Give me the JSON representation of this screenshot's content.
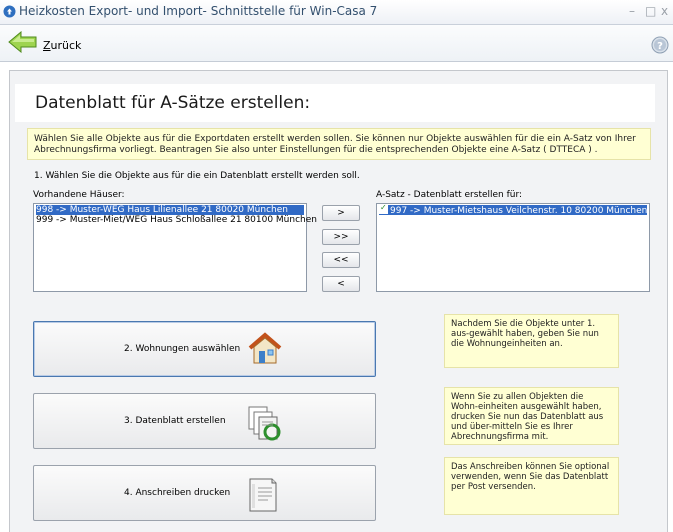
{
  "window": {
    "title": "Heizkosten Export- und Import- Schnittstelle für Win-Casa 7",
    "minimize": "–",
    "maximize": "□",
    "close": "x"
  },
  "toolbar": {
    "back_label_first": "Z",
    "back_label_rest": "urück"
  },
  "page": {
    "title": "Datenblatt für A-Sätze erstellen:",
    "info": "Wählen Sie alle Objekte aus für die Exportdaten erstellt werden sollen. Sie können nur Objekte auswählen für die ein A-Satz von Ihrer Abrechnungsfirma vorliegt. Beantragen Sie also unter Einstellungen für die entsprechenden Objekte eine A-Satz ( DTTECA ) .",
    "step1": "1. Wählen Sie die Objekte aus für die ein Datenblatt erstellt werden soll."
  },
  "available": {
    "label": "Vorhandene Häuser:",
    "items": [
      "998 -> Muster-WEG Haus  Lilienallee 21   80020 München",
      "999 -> Muster-Miet/WEG Haus  Schloßallee 21   80100 München"
    ]
  },
  "selected": {
    "label": "A-Satz - Datenblatt erstellen für:",
    "items": [
      "997 -> Muster-Mietshaus  Veilchenstr. 10   80200 München"
    ]
  },
  "move_buttons": [
    ">",
    ">>",
    "<<",
    "<"
  ],
  "actions": [
    {
      "label": "2. Wohnungen auswählen",
      "icon": "house-icon",
      "hint": "Nachdem Sie die Objekte unter 1. aus-gewählt haben, geben Sie nun die Wohnungeinheiten an."
    },
    {
      "label": "3. Datenblatt erstellen",
      "icon": "documents-icon",
      "hint": "Wenn Sie zu allen Objekten die Wohn-einheiten ausgewählt haben, drucken Sie nun das Datenblatt aus und über-mitteln Sie es Ihrer Abrechnungsfirma mit."
    },
    {
      "label": "4. Anschreiben drucken",
      "icon": "letter-icon",
      "hint": "Das Anschreiben können Sie optional verwenden, wenn Sie das Datenblatt per Post versenden."
    }
  ],
  "colors": {
    "selection": "#316ac5",
    "hint_background": "#ffffd3",
    "title_text": "#33506e"
  }
}
